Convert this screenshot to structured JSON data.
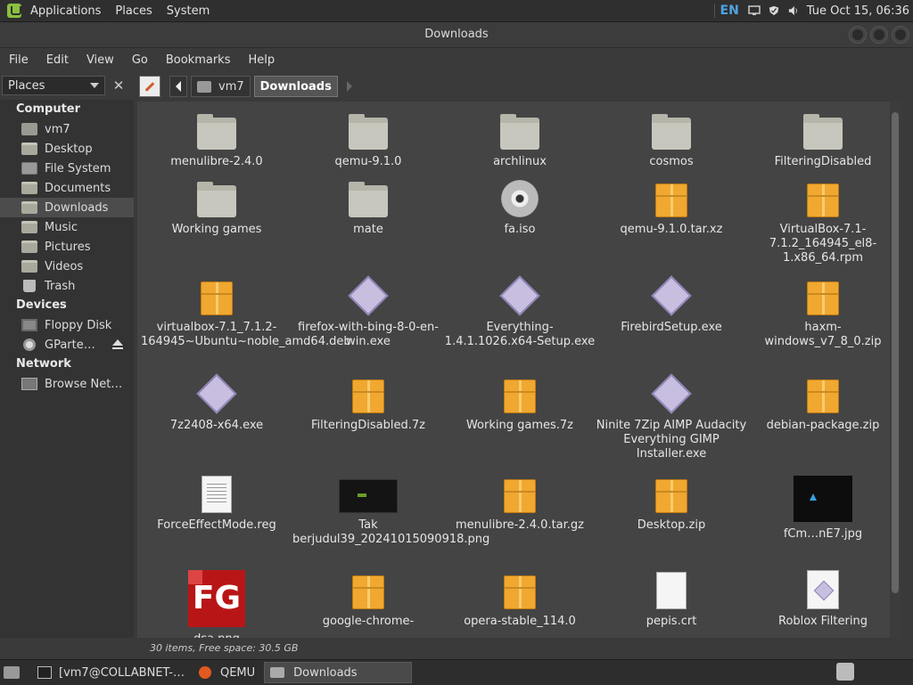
{
  "topbar": {
    "menus": [
      "Applications",
      "Places",
      "System"
    ],
    "lang": "EN",
    "clock": "Tue Oct 15, 06:36"
  },
  "window": {
    "title": "Downloads"
  },
  "menubar": [
    "File",
    "Edit",
    "View",
    "Go",
    "Bookmarks",
    "Help"
  ],
  "sidebar": {
    "selector_label": "Places",
    "close_label": "✕",
    "sections": {
      "computer": "Computer",
      "devices": "Devices",
      "network": "Network"
    },
    "computer_items": [
      "vm7",
      "Desktop",
      "File System",
      "Documents",
      "Downloads",
      "Music",
      "Pictures",
      "Videos",
      "Trash"
    ],
    "device_items": [
      "Floppy Disk",
      "GParte…"
    ],
    "network_items": [
      "Browse Net…"
    ]
  },
  "pathbar": {
    "crumbs": [
      "vm7",
      "Downloads"
    ]
  },
  "files": [
    {
      "name": "menulibre-2.4.0",
      "icon": "folder"
    },
    {
      "name": "qemu-9.1.0",
      "icon": "folder"
    },
    {
      "name": "archlinux",
      "icon": "folder"
    },
    {
      "name": "cosmos",
      "icon": "folder"
    },
    {
      "name": "FilteringDisabled",
      "icon": "folder"
    },
    {
      "name": "Working games",
      "icon": "folder"
    },
    {
      "name": "mate",
      "icon": "folder"
    },
    {
      "name": "fa.iso",
      "icon": "disc"
    },
    {
      "name": "qemu-9.1.0.tar.xz",
      "icon": "package"
    },
    {
      "name": "VirtualBox-7.1-7.1.2_164945_el8-1.x86_64.rpm",
      "icon": "package"
    },
    {
      "name": "virtualbox-7.1_7.1.2-164945~Ubuntu~noble_amd64.deb",
      "icon": "package"
    },
    {
      "name": "firefox-with-bing-8-0-en-win.exe",
      "icon": "exe"
    },
    {
      "name": "Everything-1.4.1.1026.x64-Setup.exe",
      "icon": "exe"
    },
    {
      "name": "FirebirdSetup.exe",
      "icon": "exe"
    },
    {
      "name": "haxm-windows_v7_8_0.zip",
      "icon": "package"
    },
    {
      "name": "7z2408-x64.exe",
      "icon": "exe"
    },
    {
      "name": "FilteringDisabled.7z",
      "icon": "package"
    },
    {
      "name": "Working games.7z",
      "icon": "package"
    },
    {
      "name": "Ninite 7Zip AIMP Audacity Everything GIMP Installer.exe",
      "icon": "exe"
    },
    {
      "name": "debian-package.zip",
      "icon": "package"
    },
    {
      "name": "ForceEffectMode.reg",
      "icon": "text"
    },
    {
      "name": "Tak berjudul39_20241015090918.png",
      "icon": "image-dark"
    },
    {
      "name": "menulibre-2.4.0.tar.gz",
      "icon": "package"
    },
    {
      "name": "Desktop.zip",
      "icon": "package"
    },
    {
      "name": "fCm…nE7.jpg",
      "icon": "image-blue"
    },
    {
      "name": "dsa.png",
      "icon": "image-fg"
    },
    {
      "name": "google-chrome-",
      "icon": "package"
    },
    {
      "name": "opera-stable_114.0",
      "icon": "package"
    },
    {
      "name": "pepis.crt",
      "icon": "doc"
    },
    {
      "name": "Roblox Filtering",
      "icon": "exe-doc"
    }
  ],
  "fg_text": "FG",
  "status": "30 items, Free space: 30.5 GB",
  "taskbar": {
    "tasks": [
      "[vm7@COLLABNET-…",
      "QEMU",
      "Downloads"
    ],
    "active": "Downloads"
  }
}
